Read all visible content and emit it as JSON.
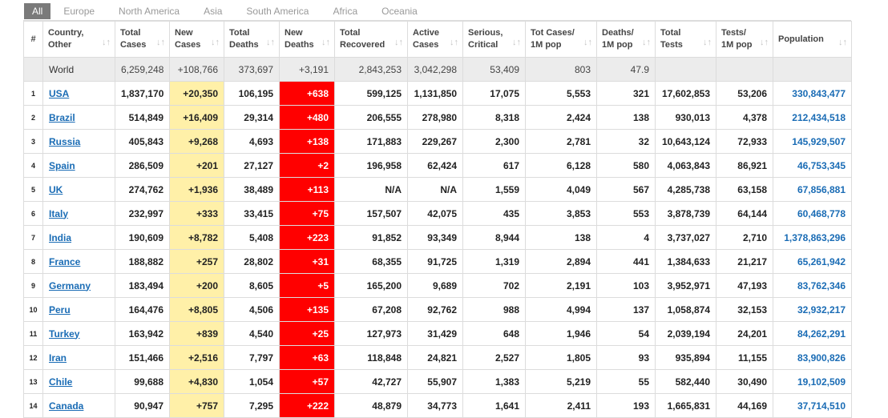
{
  "tabs": [
    "All",
    "Europe",
    "North America",
    "Asia",
    "South America",
    "Africa",
    "Oceania"
  ],
  "active_tab": "All",
  "colors": {
    "new_cases_bg": "#fff0a8",
    "new_deaths_bg": "#ff0000",
    "link": "#1a6cb5",
    "world_row_bg": "#ececec"
  },
  "headers": [
    "#",
    "Country,\nOther",
    "Total\nCases",
    "New\nCases",
    "Total\nDeaths",
    "New\nDeaths",
    "Total\nRecovered",
    "Active\nCases",
    "Serious,\nCritical",
    "Tot Cases/\n1M pop",
    "Deaths/\n1M pop",
    "Total\nTests",
    "Tests/\n1M pop",
    "Population"
  ],
  "world": {
    "num": "",
    "country": "World",
    "total_cases": "6,259,248",
    "new_cases": "+108,766",
    "total_deaths": "373,697",
    "new_deaths": "+3,191",
    "total_recovered": "2,843,253",
    "active_cases": "3,042,298",
    "serious": "53,409",
    "cases_per_1m": "803",
    "deaths_per_1m": "47.9",
    "total_tests": "",
    "tests_per_1m": "",
    "population": ""
  },
  "rows": [
    {
      "num": "1",
      "country": "USA",
      "total_cases": "1,837,170",
      "new_cases": "+20,350",
      "total_deaths": "106,195",
      "new_deaths": "+638",
      "total_recovered": "599,125",
      "active_cases": "1,131,850",
      "serious": "17,075",
      "cases_per_1m": "5,553",
      "deaths_per_1m": "321",
      "total_tests": "17,602,853",
      "tests_per_1m": "53,206",
      "population": "330,843,477"
    },
    {
      "num": "2",
      "country": "Brazil",
      "total_cases": "514,849",
      "new_cases": "+16,409",
      "total_deaths": "29,314",
      "new_deaths": "+480",
      "total_recovered": "206,555",
      "active_cases": "278,980",
      "serious": "8,318",
      "cases_per_1m": "2,424",
      "deaths_per_1m": "138",
      "total_tests": "930,013",
      "tests_per_1m": "4,378",
      "population": "212,434,518"
    },
    {
      "num": "3",
      "country": "Russia",
      "total_cases": "405,843",
      "new_cases": "+9,268",
      "total_deaths": "4,693",
      "new_deaths": "+138",
      "total_recovered": "171,883",
      "active_cases": "229,267",
      "serious": "2,300",
      "cases_per_1m": "2,781",
      "deaths_per_1m": "32",
      "total_tests": "10,643,124",
      "tests_per_1m": "72,933",
      "population": "145,929,507"
    },
    {
      "num": "4",
      "country": "Spain",
      "total_cases": "286,509",
      "new_cases": "+201",
      "total_deaths": "27,127",
      "new_deaths": "+2",
      "total_recovered": "196,958",
      "active_cases": "62,424",
      "serious": "617",
      "cases_per_1m": "6,128",
      "deaths_per_1m": "580",
      "total_tests": "4,063,843",
      "tests_per_1m": "86,921",
      "population": "46,753,345"
    },
    {
      "num": "5",
      "country": "UK",
      "total_cases": "274,762",
      "new_cases": "+1,936",
      "total_deaths": "38,489",
      "new_deaths": "+113",
      "total_recovered": "N/A",
      "active_cases": "N/A",
      "serious": "1,559",
      "cases_per_1m": "4,049",
      "deaths_per_1m": "567",
      "total_tests": "4,285,738",
      "tests_per_1m": "63,158",
      "population": "67,856,881"
    },
    {
      "num": "6",
      "country": "Italy",
      "total_cases": "232,997",
      "new_cases": "+333",
      "total_deaths": "33,415",
      "new_deaths": "+75",
      "total_recovered": "157,507",
      "active_cases": "42,075",
      "serious": "435",
      "cases_per_1m": "3,853",
      "deaths_per_1m": "553",
      "total_tests": "3,878,739",
      "tests_per_1m": "64,144",
      "population": "60,468,778"
    },
    {
      "num": "7",
      "country": "India",
      "total_cases": "190,609",
      "new_cases": "+8,782",
      "total_deaths": "5,408",
      "new_deaths": "+223",
      "total_recovered": "91,852",
      "active_cases": "93,349",
      "serious": "8,944",
      "cases_per_1m": "138",
      "deaths_per_1m": "4",
      "total_tests": "3,737,027",
      "tests_per_1m": "2,710",
      "population": "1,378,863,296"
    },
    {
      "num": "8",
      "country": "France",
      "total_cases": "188,882",
      "new_cases": "+257",
      "total_deaths": "28,802",
      "new_deaths": "+31",
      "total_recovered": "68,355",
      "active_cases": "91,725",
      "serious": "1,319",
      "cases_per_1m": "2,894",
      "deaths_per_1m": "441",
      "total_tests": "1,384,633",
      "tests_per_1m": "21,217",
      "population": "65,261,942"
    },
    {
      "num": "9",
      "country": "Germany",
      "total_cases": "183,494",
      "new_cases": "+200",
      "total_deaths": "8,605",
      "new_deaths": "+5",
      "total_recovered": "165,200",
      "active_cases": "9,689",
      "serious": "702",
      "cases_per_1m": "2,191",
      "deaths_per_1m": "103",
      "total_tests": "3,952,971",
      "tests_per_1m": "47,193",
      "population": "83,762,346"
    },
    {
      "num": "10",
      "country": "Peru",
      "total_cases": "164,476",
      "new_cases": "+8,805",
      "total_deaths": "4,506",
      "new_deaths": "+135",
      "total_recovered": "67,208",
      "active_cases": "92,762",
      "serious": "988",
      "cases_per_1m": "4,994",
      "deaths_per_1m": "137",
      "total_tests": "1,058,874",
      "tests_per_1m": "32,153",
      "population": "32,932,217"
    },
    {
      "num": "11",
      "country": "Turkey",
      "total_cases": "163,942",
      "new_cases": "+839",
      "total_deaths": "4,540",
      "new_deaths": "+25",
      "total_recovered": "127,973",
      "active_cases": "31,429",
      "serious": "648",
      "cases_per_1m": "1,946",
      "deaths_per_1m": "54",
      "total_tests": "2,039,194",
      "tests_per_1m": "24,201",
      "population": "84,262,291"
    },
    {
      "num": "12",
      "country": "Iran",
      "total_cases": "151,466",
      "new_cases": "+2,516",
      "total_deaths": "7,797",
      "new_deaths": "+63",
      "total_recovered": "118,848",
      "active_cases": "24,821",
      "serious": "2,527",
      "cases_per_1m": "1,805",
      "deaths_per_1m": "93",
      "total_tests": "935,894",
      "tests_per_1m": "11,155",
      "population": "83,900,826"
    },
    {
      "num": "13",
      "country": "Chile",
      "total_cases": "99,688",
      "new_cases": "+4,830",
      "total_deaths": "1,054",
      "new_deaths": "+57",
      "total_recovered": "42,727",
      "active_cases": "55,907",
      "serious": "1,383",
      "cases_per_1m": "5,219",
      "deaths_per_1m": "55",
      "total_tests": "582,440",
      "tests_per_1m": "30,490",
      "population": "19,102,509"
    },
    {
      "num": "14",
      "country": "Canada",
      "total_cases": "90,947",
      "new_cases": "+757",
      "total_deaths": "7,295",
      "new_deaths": "+222",
      "total_recovered": "48,879",
      "active_cases": "34,773",
      "serious": "1,641",
      "cases_per_1m": "2,411",
      "deaths_per_1m": "193",
      "total_tests": "1,665,831",
      "tests_per_1m": "44,169",
      "population": "37,714,510"
    }
  ]
}
